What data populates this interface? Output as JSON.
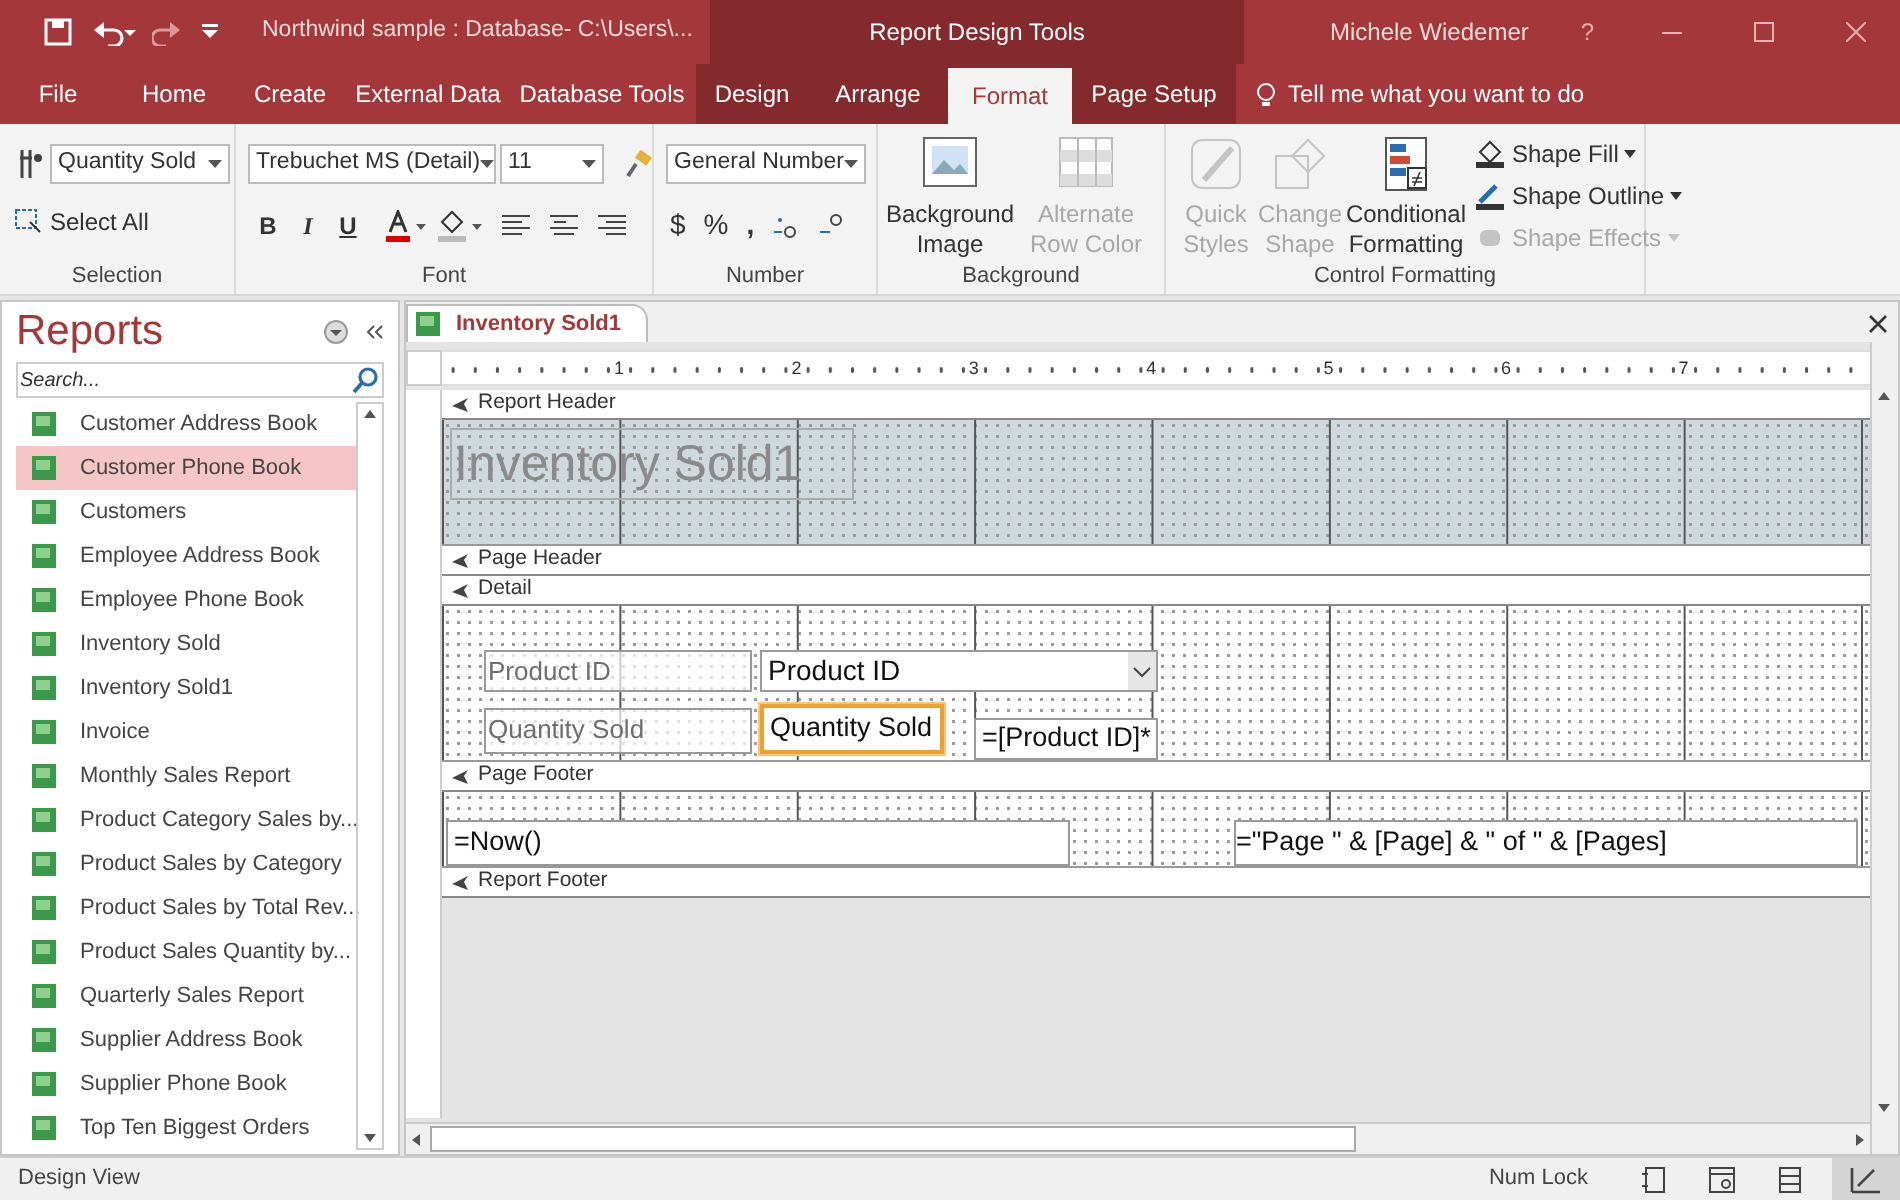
{
  "title_bar": {
    "document_title": "Northwind sample : Database- C:\\Users\\...",
    "context_label": "Report Design Tools",
    "user": "Michele Wiedemer",
    "help": "?"
  },
  "ribbon_tabs": [
    {
      "label": "File",
      "selected": false,
      "contextual": false
    },
    {
      "label": "Home",
      "selected": false,
      "contextual": false
    },
    {
      "label": "Create",
      "selected": false,
      "contextual": false
    },
    {
      "label": "External Data",
      "selected": false,
      "contextual": false
    },
    {
      "label": "Database Tools",
      "selected": false,
      "contextual": false
    },
    {
      "label": "Design",
      "selected": false,
      "contextual": true
    },
    {
      "label": "Arrange",
      "selected": false,
      "contextual": true
    },
    {
      "label": "Format",
      "selected": true,
      "contextual": true
    },
    {
      "label": "Page Setup",
      "selected": false,
      "contextual": true
    }
  ],
  "tell_me": "Tell me what you want to do",
  "ribbon_groups": {
    "selection": {
      "label": "Selection",
      "object": "Quantity Sold",
      "select_all": "Select All"
    },
    "font": {
      "label": "Font",
      "font_name": "Trebuchet MS (Detail)",
      "font_size": "11",
      "bold": "B",
      "italic": "I",
      "underline": "U"
    },
    "number": {
      "label": "Number",
      "format": "General Number",
      "currency": "$",
      "percent": "%",
      "comma": ","
    },
    "background": {
      "label": "Background",
      "buttons": [
        {
          "label": "Background Image",
          "disabled": false,
          "kind": "image"
        },
        {
          "label": "Alternate Row Color",
          "disabled": true,
          "kind": "rows"
        }
      ]
    },
    "control_formatting": {
      "label": "Control Formatting",
      "large_buttons": [
        {
          "label": "Quick Styles",
          "disabled": true,
          "kind": "styles"
        },
        {
          "label": "Change Shape",
          "disabled": true,
          "kind": "shape"
        },
        {
          "label": "Conditional Formatting",
          "disabled": false,
          "kind": "conditional"
        }
      ],
      "small_buttons": [
        {
          "label": "Shape Fill",
          "disabled": false,
          "kind": "fill"
        },
        {
          "label": "Shape Outline",
          "disabled": false,
          "kind": "outline"
        },
        {
          "label": "Shape Effects",
          "disabled": true,
          "kind": "effects"
        }
      ]
    }
  },
  "nav_pane": {
    "title": "Reports",
    "search": {
      "placeholder": "Search..."
    },
    "items": [
      {
        "label": "Customer Address Book",
        "selected": false
      },
      {
        "label": "Customer Phone Book",
        "selected": true
      },
      {
        "label": "Customers",
        "selected": false
      },
      {
        "label": "Employee Address Book",
        "selected": false
      },
      {
        "label": "Employee Phone Book",
        "selected": false
      },
      {
        "label": "Inventory Sold",
        "selected": false
      },
      {
        "label": "Inventory Sold1",
        "selected": false
      },
      {
        "label": "Invoice",
        "selected": false
      },
      {
        "label": "Monthly Sales Report",
        "selected": false
      },
      {
        "label": "Product Category Sales by...",
        "selected": false
      },
      {
        "label": "Product Sales by Category",
        "selected": false
      },
      {
        "label": "Product Sales by Total Rev...",
        "selected": false
      },
      {
        "label": "Product Sales Quantity by...",
        "selected": false
      },
      {
        "label": "Quarterly Sales Report",
        "selected": false
      },
      {
        "label": "Supplier Address Book",
        "selected": false
      },
      {
        "label": "Supplier Phone Book",
        "selected": false
      },
      {
        "label": "Top Ten Biggest Orders",
        "selected": false
      }
    ]
  },
  "document_tab": {
    "label": "Inventory Sold1"
  },
  "ruler": [
    "1",
    "2",
    "3",
    "4",
    "5",
    "6",
    "7"
  ],
  "sections": [
    {
      "label": "Report Header",
      "shaded": true,
      "controls": [
        {
          "kind": "title",
          "text": "Inventory Sold1",
          "selected": false
        }
      ]
    },
    {
      "label": "Page Header"
    },
    {
      "label": "Detail",
      "shaded": false,
      "controls": [
        {
          "kind": "label",
          "text": "Product ID",
          "selected": false
        },
        {
          "kind": "combo",
          "text": "Product ID",
          "selected": false
        },
        {
          "kind": "label",
          "text": "Quantity Sold",
          "selected": false
        },
        {
          "kind": "textbox",
          "text": "Quantity Sold",
          "selected": true
        },
        {
          "kind": "textbox",
          "text": "=[Product ID]*",
          "selected": false
        }
      ]
    },
    {
      "label": "Page Footer",
      "shaded": false,
      "controls": [
        {
          "kind": "textbox",
          "text": "=Now()",
          "selected": false
        },
        {
          "kind": "textbox_right",
          "text": "=\"Page \" & [Page] & \" of \" & [Pages]",
          "selected": false
        }
      ]
    },
    {
      "label": "Report Footer"
    }
  ],
  "status_bar": {
    "view": "Design View",
    "num_lock": "Num Lock"
  }
}
